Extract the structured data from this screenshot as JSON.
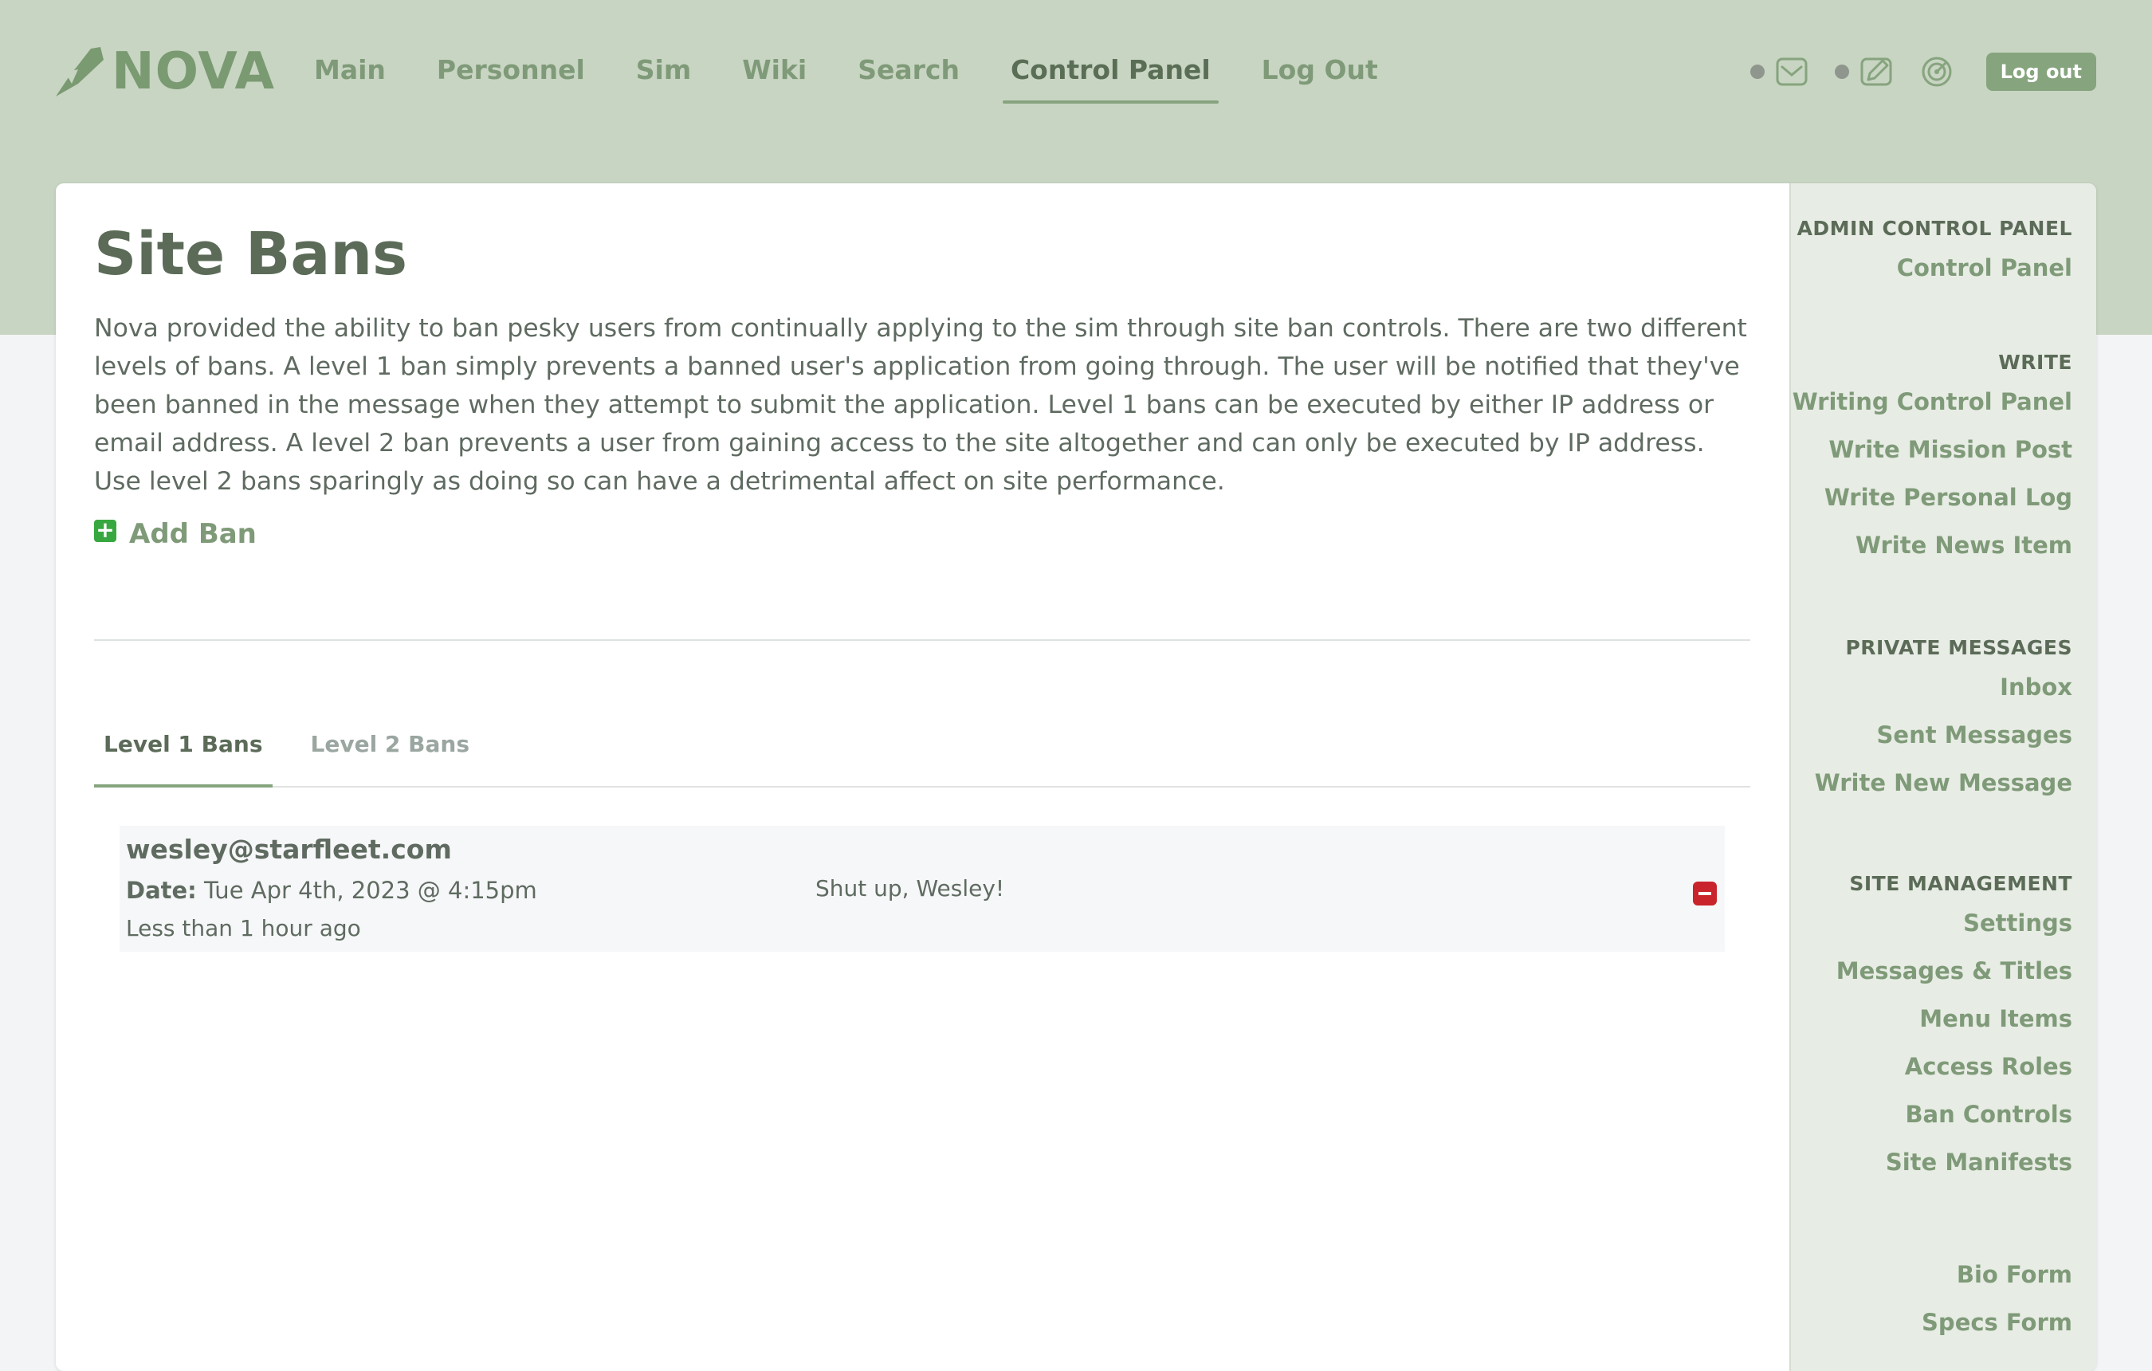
{
  "header": {
    "logo_text": "NOVA",
    "nav": [
      {
        "label": "Main"
      },
      {
        "label": "Personnel"
      },
      {
        "label": "Sim"
      },
      {
        "label": "Wiki"
      },
      {
        "label": "Search"
      },
      {
        "label": "Control Panel",
        "active": true
      },
      {
        "label": "Log Out"
      }
    ],
    "logout_button": "Log out"
  },
  "main": {
    "title": "Site Bans",
    "intro": "Nova provided the ability to ban pesky users from continually applying to the sim through site ban controls. There are two different levels of bans. A level 1 ban simply prevents a banned user's application from going through. The user will be notified that they've been banned in the message when they attempt to submit the application. Level 1 bans can be executed by either IP address or email address. A level 2 ban prevents a user from gaining access to the site altogether and can only be executed by IP address. Use level 2 bans sparingly as doing so can have a detrimental affect on site performance.",
    "add_ban": "Add Ban",
    "tabs": [
      {
        "label": "Level 1 Bans",
        "active": true
      },
      {
        "label": "Level 2 Bans",
        "active": false
      }
    ],
    "bans": [
      {
        "email": "wesley@starfleet.com",
        "date_label": "Date:",
        "date": "Tue Apr 4th, 2023 @ 4:15pm",
        "relative": "Less than 1 hour ago",
        "reason": "Shut up, Wesley!"
      }
    ]
  },
  "sidebar": {
    "sections": [
      {
        "heading": "ADMIN CONTROL PANEL",
        "links": [
          "Control Panel"
        ]
      },
      {
        "heading": "WRITE",
        "links": [
          "Writing Control Panel",
          "Write Mission Post",
          "Write Personal Log",
          "Write News Item"
        ]
      },
      {
        "heading": "PRIVATE MESSAGES",
        "links": [
          "Inbox",
          "Sent Messages",
          "Write New Message"
        ]
      },
      {
        "heading": "SITE MANAGEMENT",
        "links": [
          "Settings",
          "Messages & Titles",
          "Menu Items",
          "Access Roles",
          "Ban Controls",
          "Site Manifests"
        ]
      },
      {
        "heading": "",
        "links": [
          "Bio Form",
          "Specs Form"
        ]
      }
    ]
  },
  "colors": {
    "header_bg": "#c8d5c2",
    "accent_green": "#86a47e",
    "link_green": "#7f9a78",
    "text_dark": "#5b6b58",
    "remove_red": "#c9242b",
    "add_green": "#37a83f"
  }
}
